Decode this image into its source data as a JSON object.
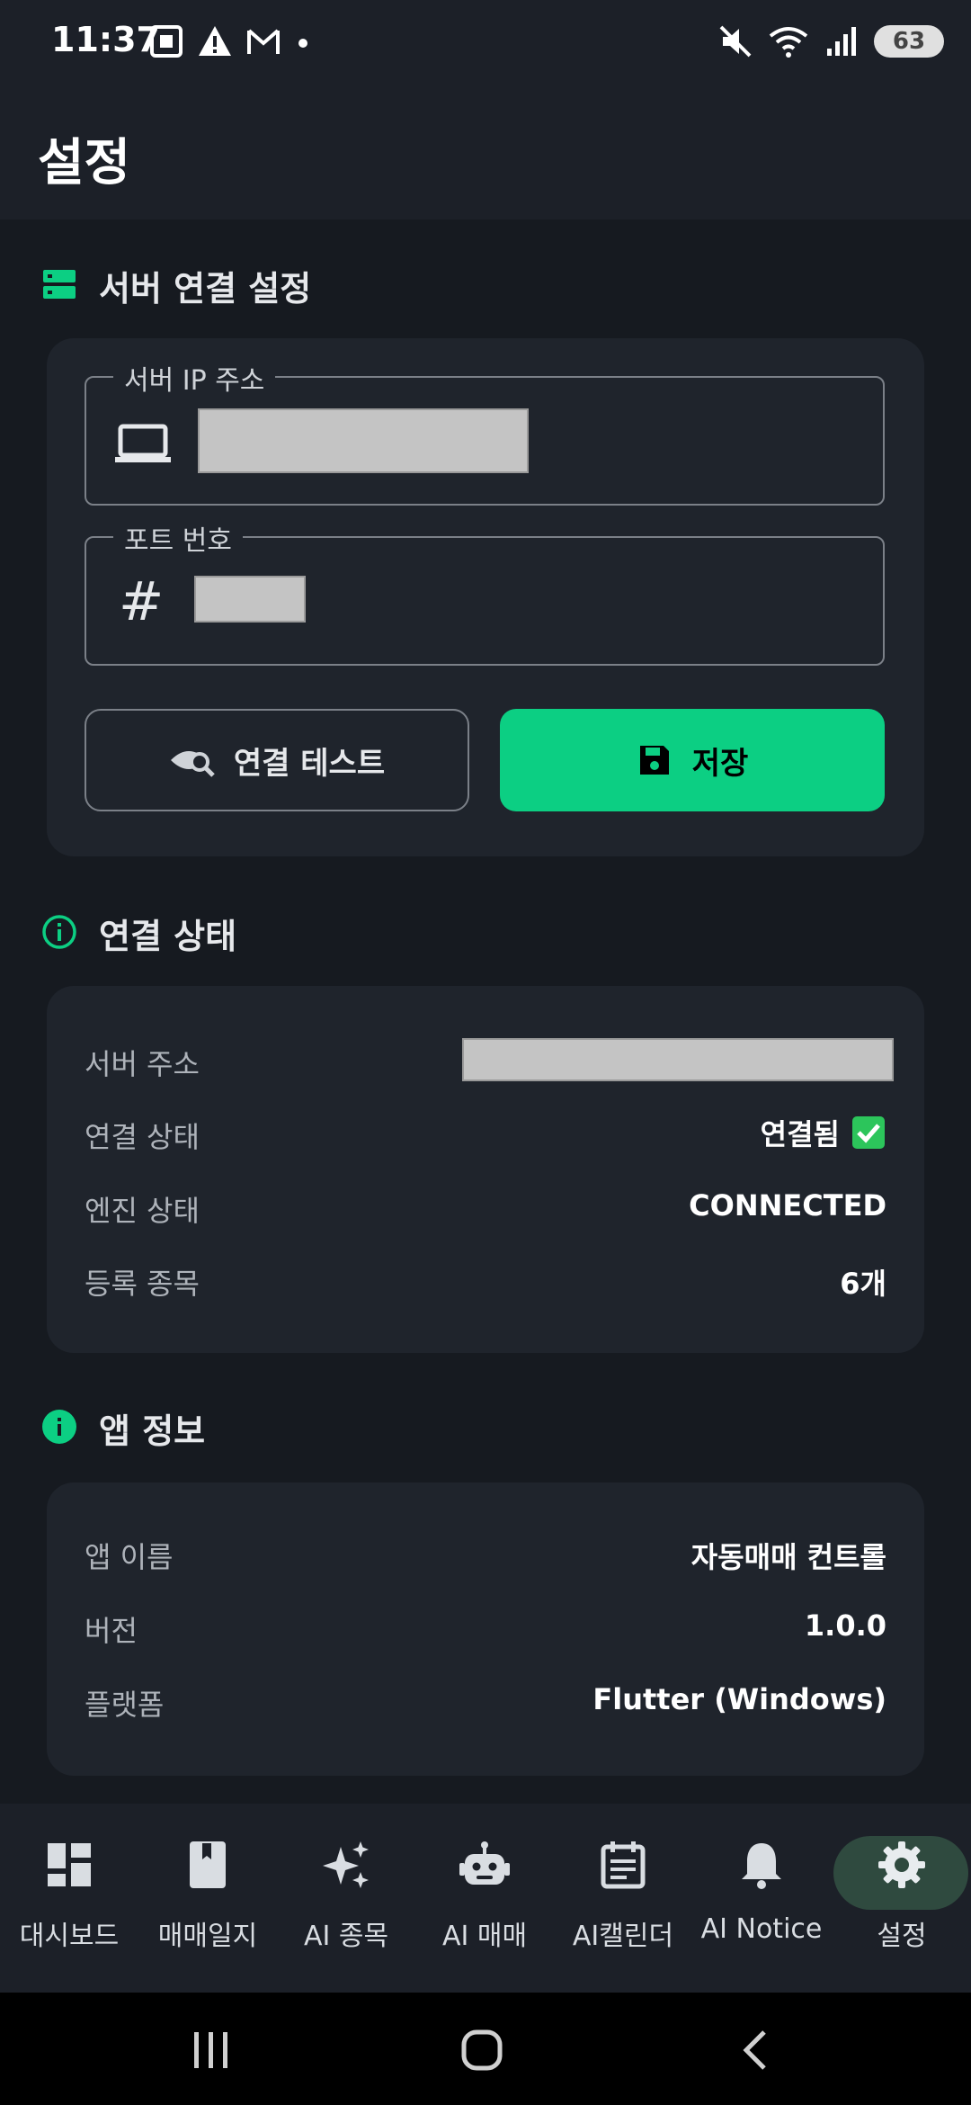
{
  "status_bar": {
    "time": "11:37",
    "battery": "63"
  },
  "app_bar": {
    "title": "설정"
  },
  "server_section": {
    "title": "서버 연결 설정",
    "ip_label": "서버 IP 주소",
    "port_label": "포트 번호",
    "test_button": "연결 테스트",
    "save_button": "저장"
  },
  "status_section": {
    "title": "연결 상태",
    "rows": [
      {
        "label": "서버 주소",
        "value": ""
      },
      {
        "label": "연결 상태",
        "value": "연결됨"
      },
      {
        "label": "엔진 상태",
        "value": "CONNECTED"
      },
      {
        "label": "등록 종목",
        "value": "6개"
      }
    ]
  },
  "app_section": {
    "title": "앱 정보",
    "rows": [
      {
        "label": "앱 이름",
        "value": "자동매매 컨트롤"
      },
      {
        "label": "버전",
        "value": "1.0.0"
      },
      {
        "label": "플랫폼",
        "value": "Flutter (Windows)"
      }
    ]
  },
  "bottom_nav": {
    "items": [
      {
        "label": "대시보드",
        "icon": "dashboard-icon"
      },
      {
        "label": "매매일지",
        "icon": "book-icon"
      },
      {
        "label": "AI 종목",
        "icon": "sparkle-icon"
      },
      {
        "label": "AI 매매",
        "icon": "robot-icon"
      },
      {
        "label": "AI캘린더",
        "icon": "calendar-icon"
      },
      {
        "label": "AI Notice",
        "icon": "bell-icon"
      },
      {
        "label": "설정",
        "icon": "gear-icon",
        "active": true
      }
    ]
  },
  "colors": {
    "accent": "#0ccf83",
    "background": "#161a20",
    "card": "#1f242c"
  }
}
